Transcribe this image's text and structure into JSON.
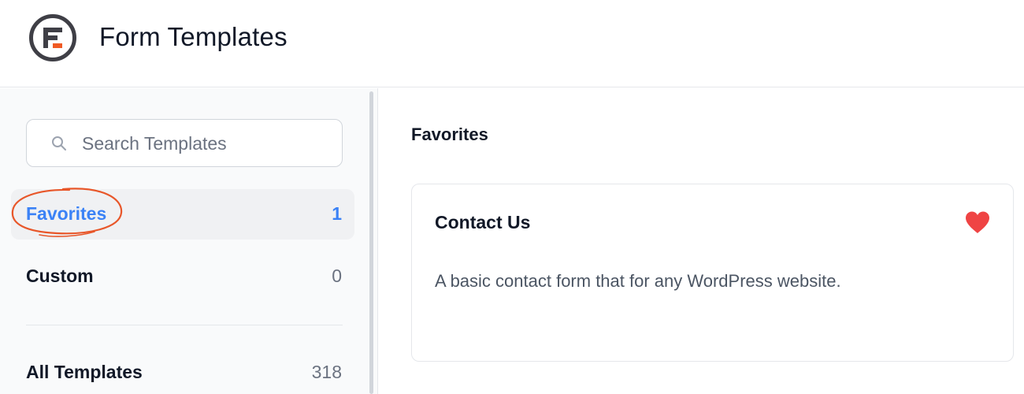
{
  "header": {
    "title": "Form Templates",
    "logo_icon": "formidable-logo-icon",
    "logo_accent": "#f05a24"
  },
  "sidebar": {
    "search": {
      "placeholder": "Search Templates",
      "value": "",
      "icon": "search-icon"
    },
    "items": [
      {
        "label": "Favorites",
        "count": "1",
        "active": true
      },
      {
        "label": "Custom",
        "count": "0",
        "active": false
      },
      {
        "label": "All Templates",
        "count": "318",
        "active": false
      }
    ],
    "highlight_color": "#e8572a"
  },
  "main": {
    "section_title": "Favorites",
    "cards": [
      {
        "title": "Contact Us",
        "description": "A basic contact form that for any WordPress website.",
        "favorite_icon": "heart-icon",
        "favorite_color": "#ef4444"
      }
    ]
  },
  "colors": {
    "accent": "#3b82f6"
  }
}
